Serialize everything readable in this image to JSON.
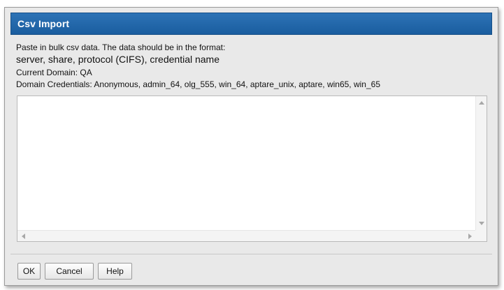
{
  "dialog": {
    "title": "Csv Import",
    "instruction_line1": "Paste in bulk csv data. The data should be in the format:",
    "format_line": "server, share, protocol (CIFS), credential name",
    "current_domain": "Current Domain: QA",
    "domain_credentials": "Domain Credentials: Anonymous, admin_64, olg_555, win_64, aptare_unix, aptare, win65, win_65",
    "textarea_value": "",
    "buttons": {
      "ok": "OK",
      "cancel": "Cancel",
      "help": "Help"
    }
  },
  "colors": {
    "titlebar": "#1f64a8",
    "dialog_background": "#e9e9e9",
    "textarea_background": "#ffffff"
  }
}
